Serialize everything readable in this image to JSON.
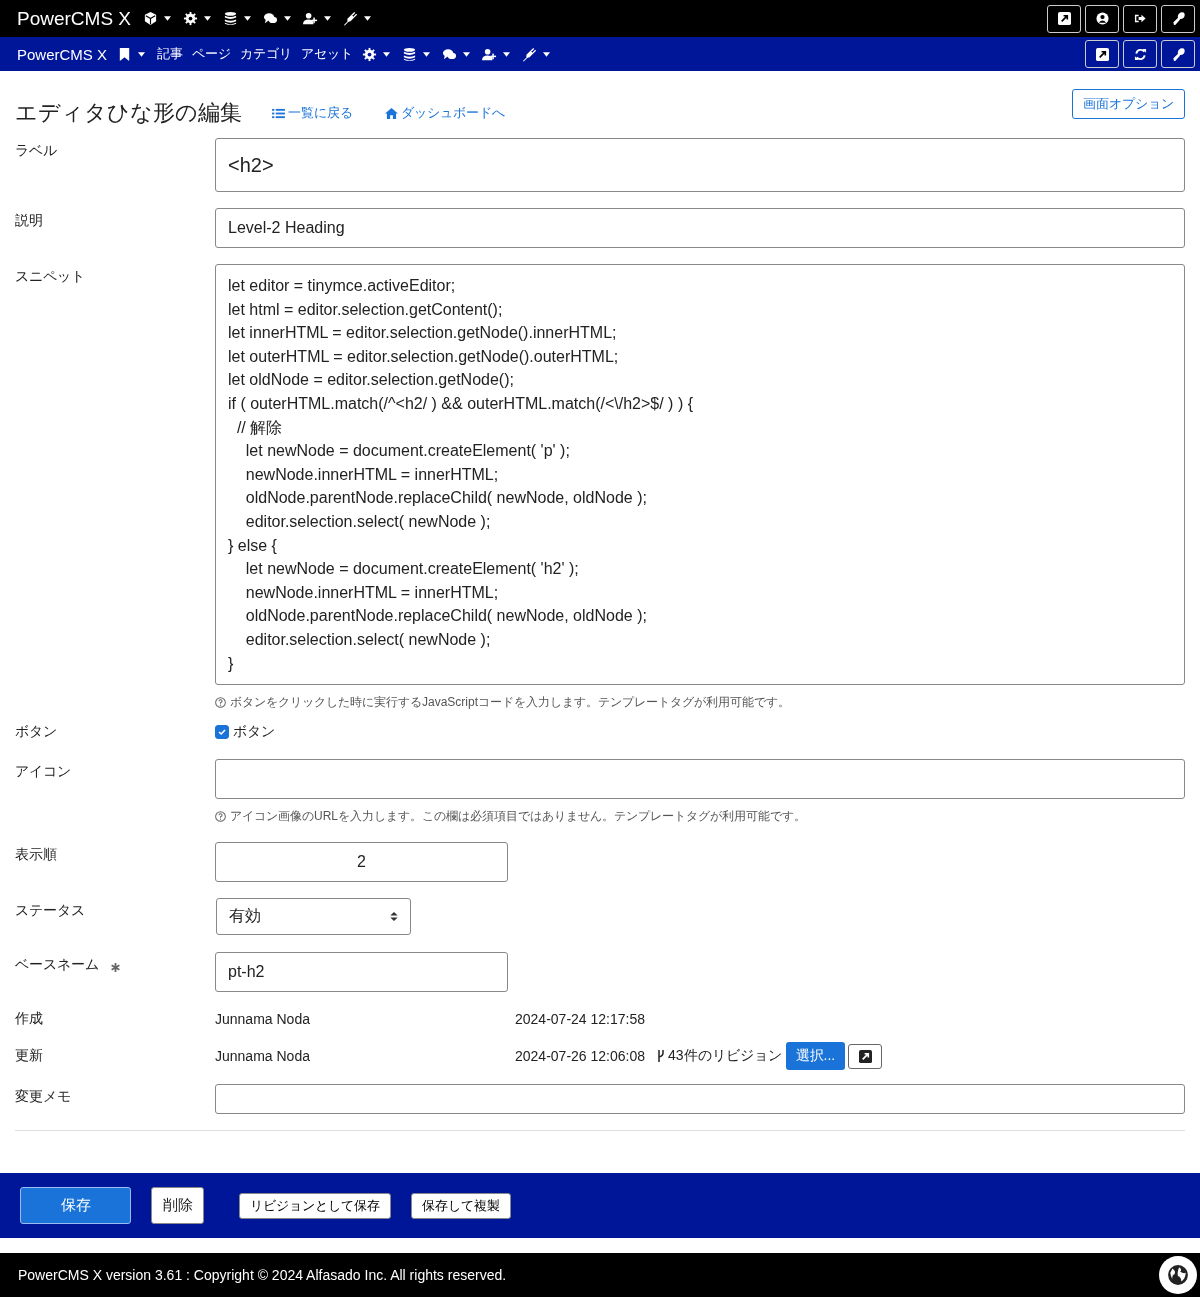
{
  "top_bar": {
    "brand": "PowerCMS X"
  },
  "nav_bar": {
    "brand": "PowerCMS X",
    "links": [
      "記事",
      "ページ",
      "カテゴリ",
      "アセット"
    ]
  },
  "header": {
    "title": "エディタひな形の編集",
    "back_link": "一覧に戻る",
    "dashboard_link": "ダッシュボードへ",
    "options_button": "画面オプション"
  },
  "form": {
    "label": {
      "label": "ラベル",
      "value": "<h2>"
    },
    "description": {
      "label": "説明",
      "value": "Level-2 Heading"
    },
    "snippet": {
      "label": "スニペット",
      "lines": [
        "let editor = tinymce.activeEditor;",
        "let html = editor.selection.getContent();",
        "let innerHTML = editor.selection.getNode().innerHTML;",
        "let outerHTML = editor.selection.getNode().outerHTML;",
        "let oldNode = editor.selection.getNode();",
        "if ( outerHTML.match(/^<h2/ ) && outerHTML.match(/<\\/h2>$/ ) ) {",
        "  // 解除",
        "    let newNode = document.createElement( 'p' );",
        "    newNode.innerHTML = innerHTML;",
        "    oldNode.parentNode.replaceChild( newNode, oldNode );",
        "    editor.selection.select( newNode );",
        "} else {",
        "    let newNode = document.createElement( 'h2' );",
        "    newNode.innerHTML = innerHTML;",
        "    oldNode.parentNode.replaceChild( newNode, oldNode );",
        "    editor.selection.select( newNode );",
        "}"
      ],
      "hint": "ボタンをクリックした時に実行するJavaScriptコードを入力します。テンプレートタグが利用可能です。"
    },
    "button": {
      "label": "ボタン",
      "checkbox_label": "ボタン",
      "checked": true
    },
    "icon": {
      "label": "アイコン",
      "hint": "アイコン画像のURLを入力します。この欄は必須項目ではありません。テンプレートタグが利用可能です。"
    },
    "order": {
      "label": "表示順",
      "value": "2"
    },
    "status": {
      "label": "ステータス",
      "value": "有効"
    },
    "basename": {
      "label": "ベースネーム",
      "required": true,
      "value": "pt-h2"
    },
    "created": {
      "label": "作成",
      "user": "Junnama Noda",
      "date": "2024-07-24 12:17:58"
    },
    "modified": {
      "label": "更新",
      "user": "Junnama Noda",
      "date": "2024-07-26 12:06:08",
      "revisions": "43件のリビジョン",
      "select_button": "選択..."
    },
    "change_memo": {
      "label": "変更メモ"
    }
  },
  "actions": [
    {
      "label": "保存",
      "kind": "primary"
    },
    {
      "label": "削除",
      "kind": "default"
    },
    {
      "label": "リビジョンとして保存",
      "kind": "small"
    },
    {
      "label": "保存して複製",
      "kind": "small"
    }
  ],
  "footer": {
    "text": "PowerCMS X version 3.61 : Copyright © 2024 Alfasado Inc. All rights reserved."
  }
}
